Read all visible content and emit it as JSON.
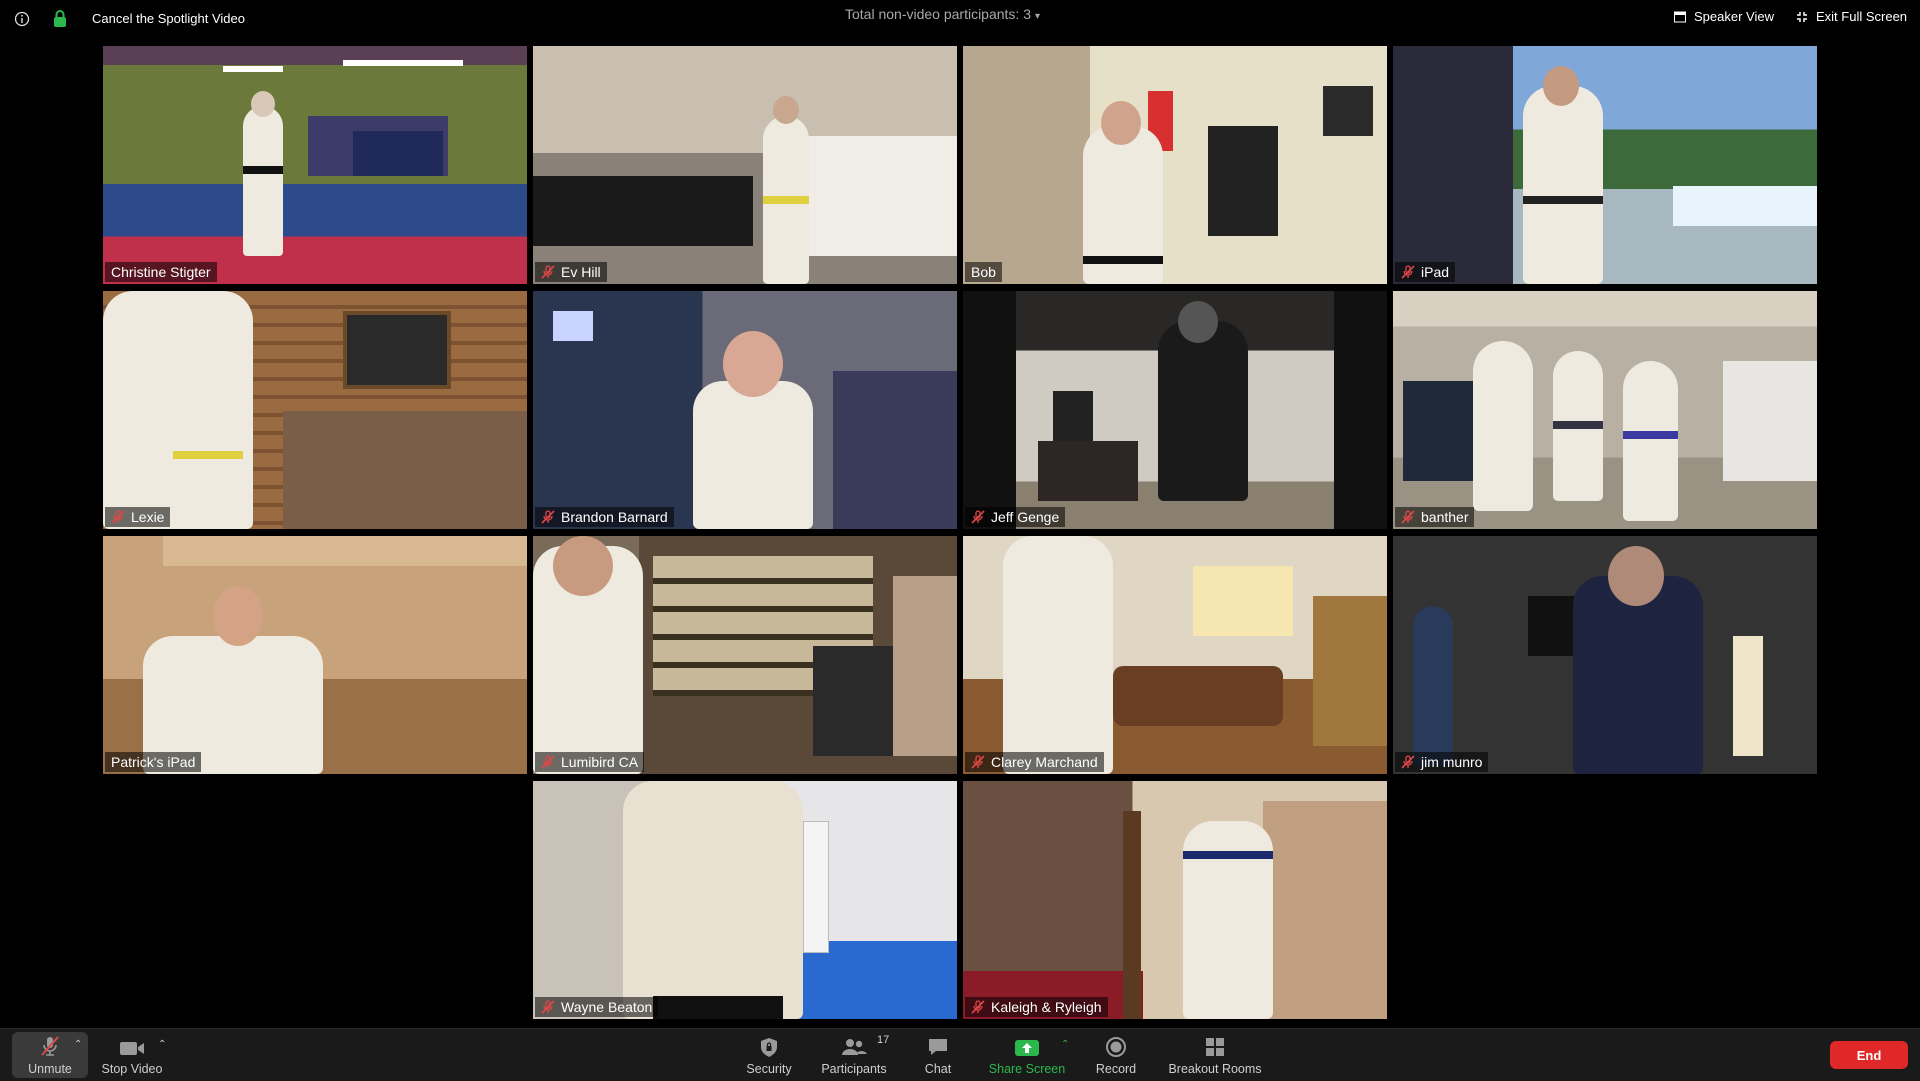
{
  "topbar": {
    "spotlight_label": "Cancel the Spotlight Video",
    "center_label": "Total non-video participants: 3",
    "speaker_view_label": "Speaker View",
    "exit_fullscreen_label": "Exit Full Screen"
  },
  "participants": [
    {
      "name": "Christine Stigter",
      "muted": false,
      "active": true
    },
    {
      "name": "Ev Hill",
      "muted": true
    },
    {
      "name": "Bob",
      "muted": false
    },
    {
      "name": "iPad",
      "muted": true
    },
    {
      "name": "Lexie",
      "muted": true
    },
    {
      "name": "Brandon Barnard",
      "muted": true
    },
    {
      "name": "Jeff Genge",
      "muted": true
    },
    {
      "name": "banther",
      "muted": true
    },
    {
      "name": "Patrick's iPad",
      "muted": false
    },
    {
      "name": "Lumibird CA",
      "muted": true
    },
    {
      "name": "Clarey Marchand",
      "muted": true
    },
    {
      "name": "jim munro",
      "muted": true
    },
    {
      "name": "Wayne Beaton",
      "muted": true
    },
    {
      "name": "Kaleigh & Ryleigh",
      "muted": true
    }
  ],
  "toolbar": {
    "unmute": "Unmute",
    "stop_video": "Stop Video",
    "security": "Security",
    "participants": "Participants",
    "participants_count": "17",
    "chat": "Chat",
    "share_screen": "Share Screen",
    "record": "Record",
    "breakout_rooms": "Breakout Rooms",
    "end": "End"
  },
  "colors": {
    "active_border": "#e8e47a",
    "share_green": "#2db84d",
    "end_red": "#e02828",
    "mute_red": "#e04848"
  }
}
